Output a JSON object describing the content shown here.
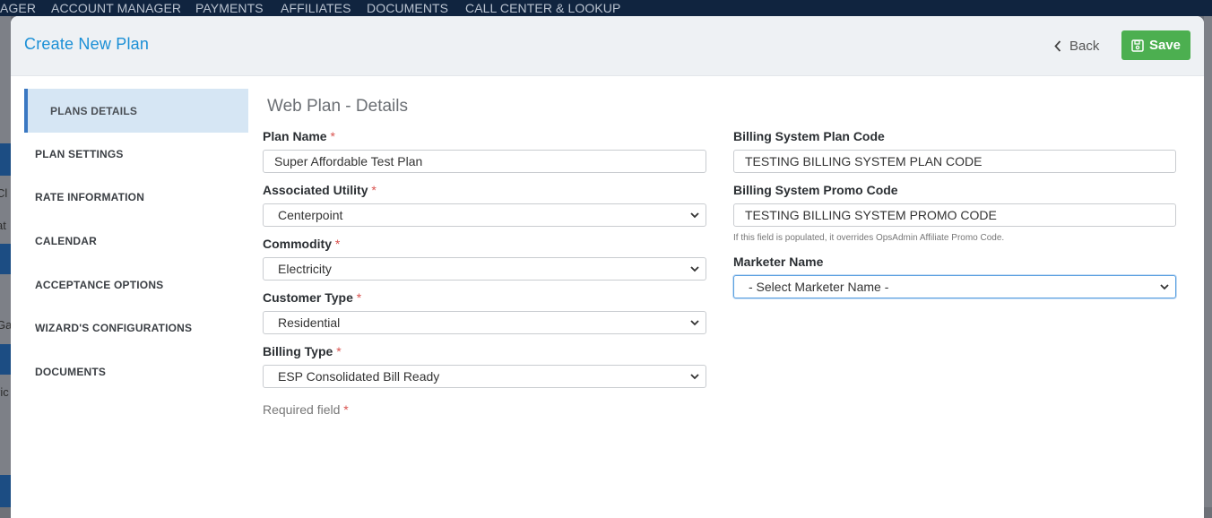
{
  "background_nav": {
    "items": [
      "AGER",
      "ACCOUNT MANAGER",
      "PAYMENTS",
      "AFFILIATES",
      "DOCUMENTS",
      "CALL CENTER & LOOKUP"
    ],
    "bg_texts": [
      "Cl",
      "at",
      "Ga",
      "ric"
    ]
  },
  "modal": {
    "title": "Create New Plan",
    "back_label": "Back",
    "save_label": "Save"
  },
  "sidebar": {
    "items": [
      {
        "label": "PLANS DETAILS",
        "active": true
      },
      {
        "label": "PLAN SETTINGS",
        "active": false
      },
      {
        "label": "RATE INFORMATION",
        "active": false
      },
      {
        "label": "CALENDAR",
        "active": false
      },
      {
        "label": "ACCEPTANCE OPTIONS",
        "active": false
      },
      {
        "label": "WIZARD'S CONFIGURATIONS",
        "active": false
      },
      {
        "label": "DOCUMENTS",
        "active": false
      }
    ]
  },
  "form": {
    "section_title": "Web Plan - Details",
    "required_marker": "*",
    "plan_name": {
      "label": "Plan Name",
      "value": "Super Affordable Test Plan"
    },
    "associated_utility": {
      "label": "Associated Utility",
      "value": "Centerpoint"
    },
    "commodity": {
      "label": "Commodity",
      "value": "Electricity"
    },
    "customer_type": {
      "label": "Customer Type",
      "value": "Residential"
    },
    "billing_type": {
      "label": "Billing Type",
      "value": "ESP Consolidated Bill Ready"
    },
    "required_field_note": "Required field",
    "billing_system_plan_code": {
      "label": "Billing System Plan Code",
      "value": "TESTING BILLING SYSTEM PLAN CODE"
    },
    "billing_system_promo_code": {
      "label": "Billing System Promo Code",
      "value": "TESTING BILLING SYSTEM PROMO CODE"
    },
    "promo_help": "If this field is populated, it overrides OpsAdmin Affiliate Promo Code.",
    "marketer_name": {
      "label": "Marketer Name",
      "value": "- Select Marketer Name -"
    }
  },
  "colors": {
    "accent_blue": "#1a8fd6",
    "save_green": "#4caf50",
    "active_menu_bg": "#d6e6f4",
    "required_red": "#d9534f"
  }
}
